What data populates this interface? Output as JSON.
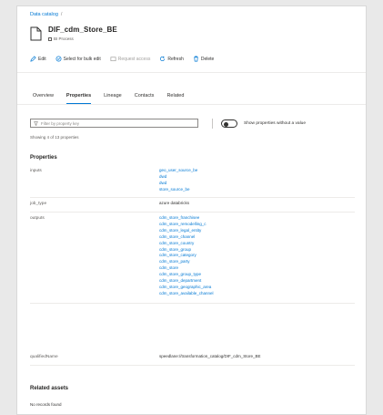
{
  "breadcrumb": {
    "root": "Data catalog",
    "sep": "/"
  },
  "asset": {
    "name": "DIF_cdm_Store_BE",
    "type": "BI Process"
  },
  "toolbar": {
    "edit": "Edit",
    "bulk_edit": "Select for bulk edit",
    "request_access": "Request access",
    "refresh": "Refresh",
    "delete": "Delete"
  },
  "tabs": [
    "Overview",
    "Properties",
    "Lineage",
    "Contacts",
    "Related"
  ],
  "filter": {
    "placeholder": "Filter by property key"
  },
  "toggle": {
    "label": "Show properties without a value"
  },
  "showing": "Showing 4 of 13 properties",
  "properties": {
    "title": "Properties",
    "inputs_label": "inputs",
    "inputs": [
      "geo_user_source_be",
      "dwd",
      "dwd",
      "store_source_be"
    ],
    "job_type_label": "job_type",
    "job_type": "azure databricks",
    "outputs_label": "outputs",
    "outputs": [
      "cdm_store_franchisee",
      "cdm_store_remodelling_c",
      "cdm_store_legal_entity",
      "cdm_store_channel",
      "cdm_store_country",
      "cdm_store_group",
      "cdm_store_category",
      "cdm_store_party",
      "cdm_store",
      "cdm_store_group_type",
      "cdm_store_department",
      "cdm_store_geographic_area",
      "cdm_store_available_channel"
    ],
    "qualified_label": "qualifiedName",
    "qualified": "speedlane://transformation_catalog/DIF_cdm_Store_BE"
  },
  "related": {
    "title": "Related assets",
    "empty": "No records found"
  }
}
